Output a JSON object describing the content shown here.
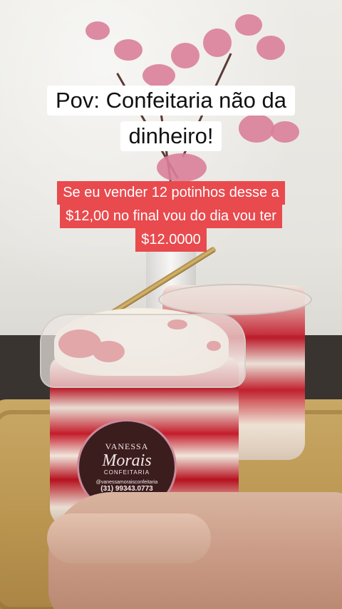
{
  "caption": {
    "title_lines": [
      "Pov: Confeitaria não da",
      "dinheiro!"
    ],
    "subtitle_lines": [
      "Se eu vender 12 potinhos desse a",
      "$12,00 no final vou do dia vou ter",
      "$12.0000"
    ]
  },
  "product_label": {
    "brand_top": "VANESSA",
    "brand_script": "Morais",
    "brand_sub": "CONFEITARIA",
    "handle": "@vanessamoraisconfeitaria",
    "phone": "(31) 99343.0773"
  },
  "colors": {
    "caption_bg": "#ffffff",
    "subtitle_bg": "#e84a4e",
    "accent_red": "#c2101f"
  }
}
